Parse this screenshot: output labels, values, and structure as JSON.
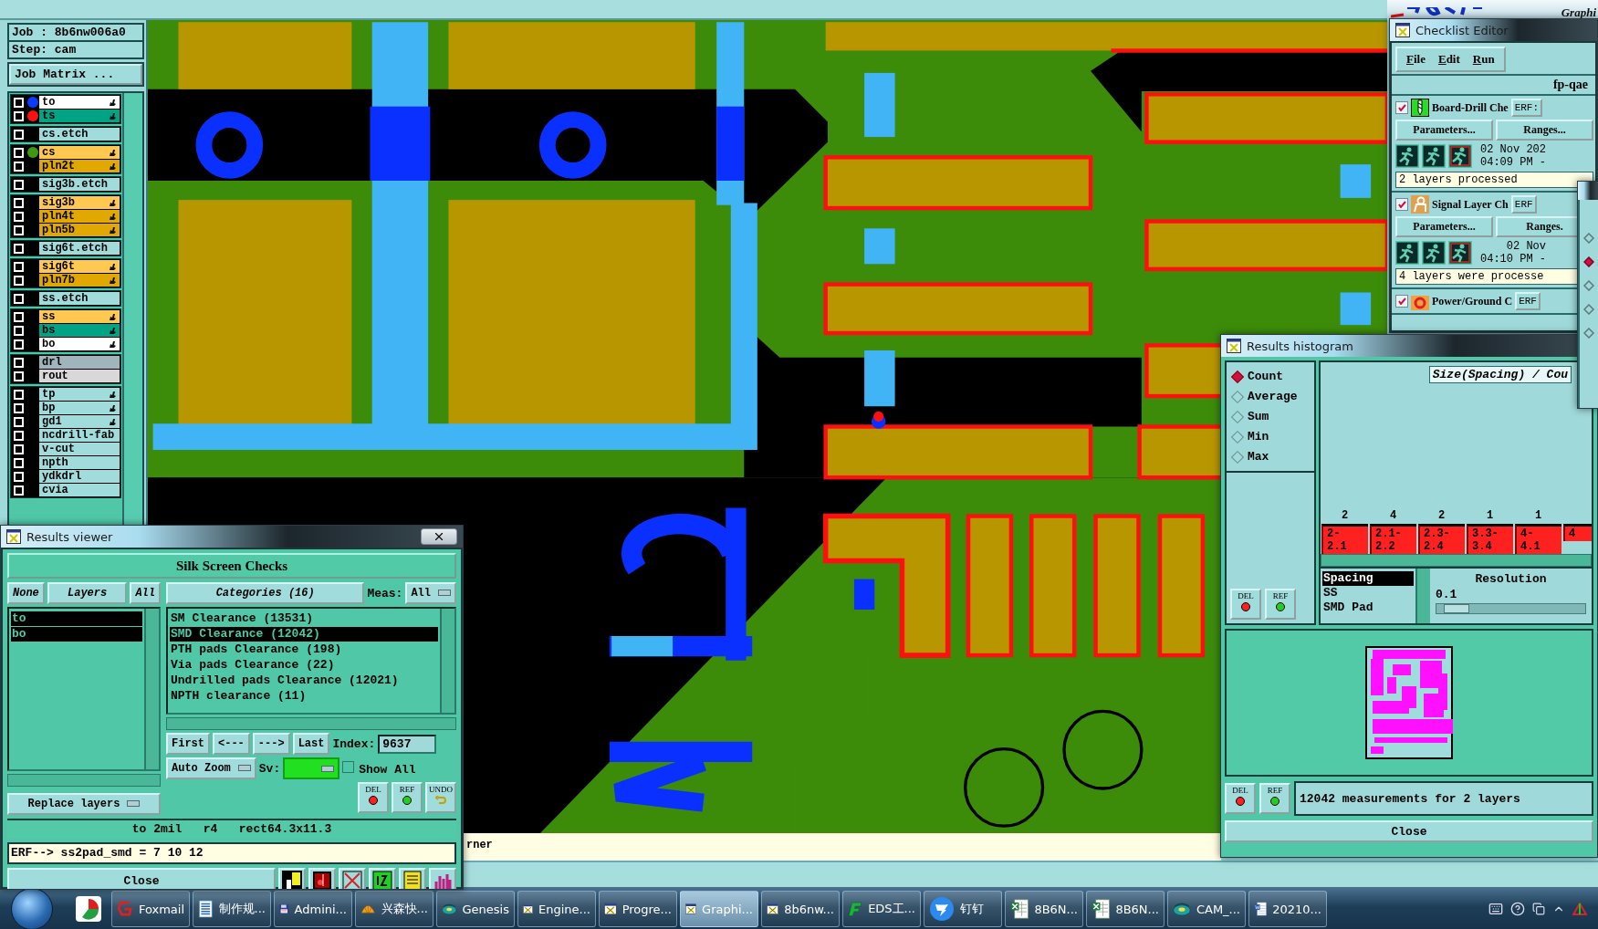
{
  "top_bar": {
    "logo_tagline": "Graphi"
  },
  "job_panel": {
    "job": "Job : 8b6nw006a0",
    "step": "Step: cam",
    "matrix_button": "Job Matrix ...",
    "layer_groups": [
      {
        "layers": [
          {
            "name": "to",
            "color": "#ffffff",
            "dot": {
              "color": "#0a3cff"
            },
            "editable": true,
            "checked": false
          },
          {
            "name": "ts",
            "color": "#00a384",
            "dot": {
              "color": "#ff1010"
            },
            "editable": true,
            "checked": false
          }
        ]
      },
      {
        "layers": [
          {
            "name": "cs.etch",
            "color": "#a0dcdc",
            "editable": false,
            "checked": false
          }
        ]
      },
      {
        "layers": [
          {
            "name": "cs",
            "color": "#ffc850",
            "dot": {
              "color": "#3c9a10"
            },
            "editable": true,
            "checked": false
          },
          {
            "name": "pln2t",
            "color": "#e0a800",
            "editable": true,
            "checked": false
          }
        ]
      },
      {
        "layers": [
          {
            "name": "sig3b.etch",
            "color": "#a0dcdc",
            "editable": false,
            "checked": false
          }
        ]
      },
      {
        "layers": [
          {
            "name": "sig3b",
            "color": "#ffc850",
            "editable": true,
            "checked": false
          },
          {
            "name": "pln4t",
            "color": "#e0a800",
            "editable": true,
            "checked": false
          },
          {
            "name": "pln5b",
            "color": "#e0a800",
            "editable": true,
            "checked": false
          }
        ]
      },
      {
        "layers": [
          {
            "name": "sig6t.etch",
            "color": "#a0dcdc",
            "editable": false,
            "checked": false
          }
        ]
      },
      {
        "layers": [
          {
            "name": "sig6t",
            "color": "#ffc850",
            "editable": true,
            "checked": false
          },
          {
            "name": "pln7b",
            "color": "#e0a800",
            "editable": true,
            "checked": false
          }
        ]
      },
      {
        "layers": [
          {
            "name": "ss.etch",
            "color": "#a0dcdc",
            "editable": false,
            "checked": false
          }
        ]
      },
      {
        "layers": [
          {
            "name": "ss",
            "color": "#ffc850",
            "editable": true,
            "checked": false
          },
          {
            "name": "bs",
            "color": "#00a384",
            "editable": true,
            "checked": false
          },
          {
            "name": "bo",
            "color": "#ffffff",
            "editable": true,
            "checked": false
          }
        ]
      },
      {
        "layers": [
          {
            "name": "drl",
            "color": "#a0b4bc",
            "editable": false,
            "checked": false
          },
          {
            "name": "rout",
            "color": "#d8d8d8",
            "editable": false,
            "checked": false
          }
        ]
      },
      {
        "layers": [
          {
            "name": "tp",
            "color": "#a0dcdc",
            "editable": true,
            "checked": false
          },
          {
            "name": "bp",
            "color": "#a0dcdc",
            "editable": true,
            "checked": false
          },
          {
            "name": "gd1",
            "color": "#a0dcdc",
            "editable": true,
            "checked": false
          },
          {
            "name": "ncdrill-fab",
            "color": "#a0dcdc",
            "editable": false,
            "checked": false
          },
          {
            "name": "v-cut",
            "color": "#a0dcdc",
            "editable": false,
            "checked": false
          },
          {
            "name": "npth",
            "color": "#a0dcdc",
            "editable": false,
            "checked": false
          },
          {
            "name": "ydkdrl",
            "color": "#a0dcdc",
            "editable": false,
            "checked": false
          },
          {
            "name": "cvia",
            "color": "#a0dcdc",
            "editable": false,
            "checked": false
          }
        ]
      }
    ]
  },
  "canvas": {
    "status_text": "rner"
  },
  "results_viewer": {
    "title": "Results viewer",
    "heading": "Silk Screen Checks",
    "layer_buttons": [
      "None",
      "Layers",
      "All"
    ],
    "layers": [
      {
        "name": "to",
        "selected": true
      },
      {
        "name": "bo",
        "selected": true
      }
    ],
    "replace_mode": "Replace layers",
    "categories_button": "Categories (16)",
    "meas_label": "Meas:",
    "meas_value": "All",
    "categories": [
      {
        "label": "SM Clearance (13531)",
        "selected": false
      },
      {
        "label": "SMD Clearance (12042)",
        "selected": true
      },
      {
        "label": "PTH pads Clearance (198)",
        "selected": false
      },
      {
        "label": "Via pads Clearance (22)",
        "selected": false
      },
      {
        "label": "Undrilled pads Clearance (12021)",
        "selected": false
      },
      {
        "label": "NPTH clearance (11)",
        "selected": false
      }
    ],
    "nav_buttons": [
      "First",
      "<---",
      "--->",
      "Last"
    ],
    "index_label": "Index:",
    "index_value": "9637",
    "zoom_mode": "Auto Zoom",
    "sv_label": "Sv:",
    "show_all": {
      "label": "Show All",
      "checked": false
    },
    "tool_buttons": [
      {
        "label": "DEL",
        "kind": "del"
      },
      {
        "label": "REF",
        "kind": "ref"
      },
      {
        "label": "UNDO",
        "kind": "undo"
      }
    ],
    "info": "to 2mil   r4   rect64.3x11.3",
    "erf_line": "ERF--> ss2pad_smd = 7 10 12",
    "close": "Close"
  },
  "checklist_editor": {
    "title": "Checklist Editor",
    "menus": [
      "File",
      "Edit",
      "Run"
    ],
    "checklist": "fp-qae",
    "actions": [
      {
        "name": "Board-Drill Che",
        "kind": "drill",
        "checked": true,
        "erf": "ERF:",
        "parameters": "Parameters...",
        "ranges": "Ranges...",
        "date": "02 Nov 202",
        "time": "04:09 PM -",
        "status": "2 layers processed"
      },
      {
        "name": "Signal Layer Ch",
        "kind": "signal",
        "checked": true,
        "erf": "ERF",
        "parameters": "Parameters...",
        "ranges": "Ranges.",
        "date": "02 Nov",
        "time": "04:10 PM -",
        "status": "4 layers were processe"
      },
      {
        "name": "Power/Ground C",
        "kind": "power",
        "checked": true,
        "erf": "ERF"
      }
    ]
  },
  "edge_dialog": {
    "options": [
      {
        "selected": false
      },
      {
        "selected": true
      },
      {
        "selected": false
      },
      {
        "selected": false
      },
      {
        "selected": false
      }
    ]
  },
  "results_histogram": {
    "title": "Results histogram",
    "modes": [
      {
        "label": "Count",
        "selected": true
      },
      {
        "label": "Average",
        "selected": false
      },
      {
        "label": "Sum",
        "selected": false
      },
      {
        "label": "Min",
        "selected": false
      },
      {
        "label": "Max",
        "selected": false
      }
    ],
    "axis_title": "Size(Spacing) / Cou",
    "bins": [
      {
        "count": "2",
        "range": "2-2.1"
      },
      {
        "count": "4",
        "range": "2.1-2.2"
      },
      {
        "count": "2",
        "range": "2.3-2.4"
      },
      {
        "count": "1",
        "range": "3.3-3.4"
      },
      {
        "count": "1",
        "range": "4-4.1"
      },
      {
        "range": "4"
      }
    ],
    "attributes": [
      {
        "label": "Spacing",
        "selected": true
      },
      {
        "label": "SS",
        "selected": false
      },
      {
        "label": "SMD Pad",
        "selected": false
      }
    ],
    "resolution_label": "Resolution",
    "resolution_value": "0.1",
    "resolution": {
      "level": 0.05
    },
    "side_buttons": [
      {
        "label": "DEL",
        "kind": "del"
      },
      {
        "label": "REF",
        "kind": "ref"
      }
    ],
    "status_buttons": [
      {
        "label": "DEL",
        "kind": "del"
      },
      {
        "label": "REF",
        "kind": "ref"
      }
    ],
    "status": "12042 measurements for 2 layers",
    "close": "Close"
  },
  "taskbar": {
    "items": [
      {
        "label": "Foxmail",
        "kind": "mail",
        "selected": false
      },
      {
        "label": "制作规...",
        "kind": "doc",
        "selected": false
      },
      {
        "label": "Admini...",
        "kind": "save",
        "selected": false
      },
      {
        "label": "兴森快...",
        "kind": "shell",
        "selected": false
      },
      {
        "label": "Genesis",
        "kind": "disc",
        "selected": false
      },
      {
        "label": "Engine...",
        "kind": "xwin",
        "selected": false
      },
      {
        "label": "Progre...",
        "kind": "xwin",
        "selected": false
      },
      {
        "label": "Graphi...",
        "kind": "xwin",
        "selected": true
      },
      {
        "label": "8b6nw...",
        "kind": "xwin",
        "selected": false
      },
      {
        "label": "EDS工...",
        "kind": "eds",
        "selected": false
      },
      {
        "label": "钉钉",
        "kind": "wing",
        "selected": false
      },
      {
        "label": "8B6N...",
        "kind": "sheet",
        "selected": false
      },
      {
        "label": "8B6N...",
        "kind": "sheet",
        "selected": false
      },
      {
        "label": "CAM_...",
        "kind": "disc",
        "selected": false
      },
      {
        "label": "20210...",
        "kind": "word",
        "selected": false
      }
    ]
  }
}
